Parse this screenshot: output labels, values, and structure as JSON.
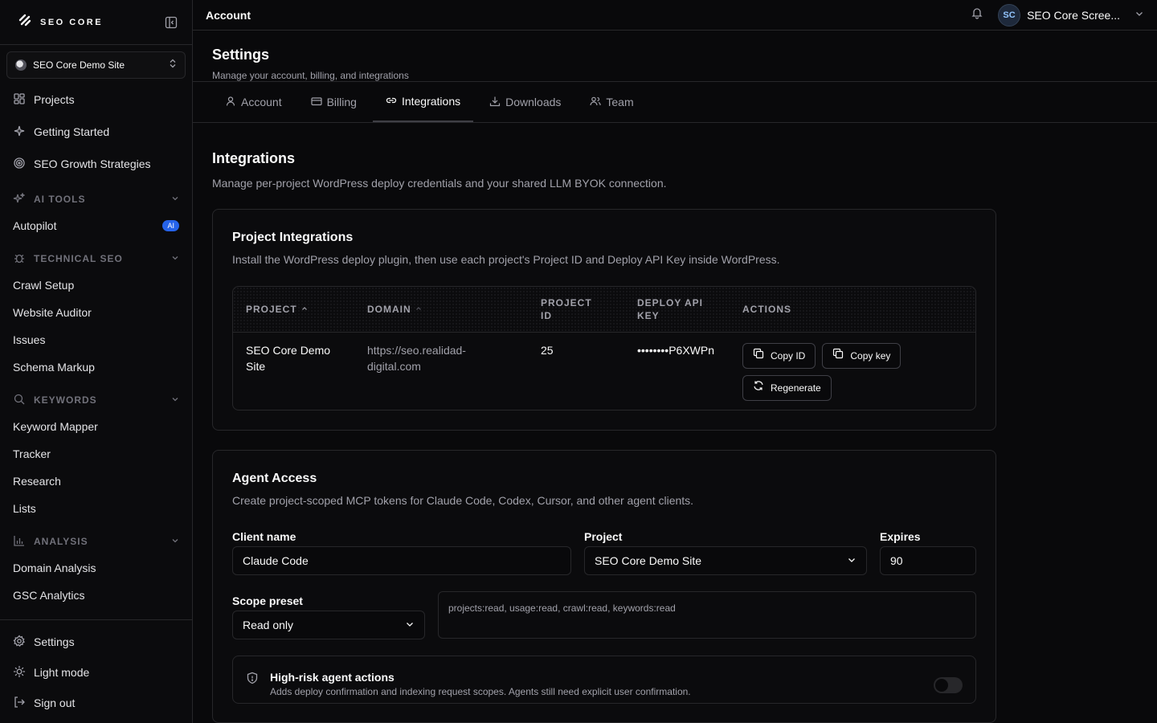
{
  "brand": {
    "name": "SEO CORE"
  },
  "site_selector": {
    "value": "SEO Core Demo Site"
  },
  "nav": {
    "primary": [
      {
        "label": "Projects",
        "icon": "grid-icon"
      },
      {
        "label": "Getting Started",
        "icon": "sparkle-icon"
      },
      {
        "label": "SEO Growth Strategies",
        "icon": "target-icon"
      }
    ],
    "sections": [
      {
        "title": "AI TOOLS",
        "icon": "sparkle-icon",
        "items": [
          {
            "label": "Autopilot",
            "badge": "AI"
          }
        ]
      },
      {
        "title": "TECHNICAL SEO",
        "icon": "bug-icon",
        "items": [
          {
            "label": "Crawl Setup"
          },
          {
            "label": "Website Auditor"
          },
          {
            "label": "Issues"
          },
          {
            "label": "Schema Markup"
          }
        ]
      },
      {
        "title": "KEYWORDS",
        "icon": "search-icon",
        "items": [
          {
            "label": "Keyword Mapper"
          },
          {
            "label": "Tracker"
          },
          {
            "label": "Research"
          },
          {
            "label": "Lists"
          }
        ]
      },
      {
        "title": "ANALYSIS",
        "icon": "bar-chart-icon",
        "items": [
          {
            "label": "Domain Analysis"
          },
          {
            "label": "GSC Analytics"
          }
        ]
      }
    ],
    "bottom": [
      {
        "label": "Settings",
        "icon": "gear-icon"
      },
      {
        "label": "Light mode",
        "icon": "sun-icon"
      },
      {
        "label": "Sign out",
        "icon": "sign-out-icon"
      }
    ]
  },
  "topbar": {
    "title": "Account",
    "avatar_initials": "SC",
    "user_name": "SEO Core Scree..."
  },
  "page": {
    "title": "Settings",
    "subtitle": "Manage your account, billing, and integrations"
  },
  "tabs": [
    {
      "label": "Account"
    },
    {
      "label": "Billing"
    },
    {
      "label": "Integrations"
    },
    {
      "label": "Downloads"
    },
    {
      "label": "Team"
    }
  ],
  "integrations": {
    "title": "Integrations",
    "subtitle": "Manage per-project WordPress deploy credentials and your shared LLM BYOK connection.",
    "project_card": {
      "title": "Project Integrations",
      "subtitle": "Install the WordPress deploy plugin, then use each project's Project ID and Deploy API Key inside WordPress.",
      "columns": {
        "project": "PROJECT",
        "domain": "DOMAIN",
        "project_id_1": "PROJECT",
        "project_id_2": "ID",
        "api_key_1": "DEPLOY API",
        "api_key_2": "KEY",
        "actions": "ACTIONS"
      },
      "rows": [
        {
          "project": "SEO Core Demo Site",
          "domain": "https://seo.realidad-digital.com",
          "project_id": "25",
          "api_key": "••••••••P6XWPn"
        }
      ],
      "buttons": {
        "copy_id": "Copy ID",
        "copy_key": "Copy key",
        "regenerate": "Regenerate"
      }
    },
    "agent_card": {
      "title": "Agent Access",
      "subtitle": "Create project-scoped MCP tokens for Claude Code, Codex, Cursor, and other agent clients.",
      "client_name_label": "Client name",
      "client_name_value": "Claude Code",
      "project_label": "Project",
      "project_value": "SEO Core Demo Site",
      "expires_label": "Expires",
      "expires_value": "90",
      "scope_label": "Scope preset",
      "scope_value": "Read only",
      "scopes": "projects:read, usage:read, crawl:read, keywords:read",
      "risk_title": "High-risk agent actions",
      "risk_sub": "Adds deploy confirmation and indexing request scopes. Agents still need explicit user confirmation."
    }
  }
}
